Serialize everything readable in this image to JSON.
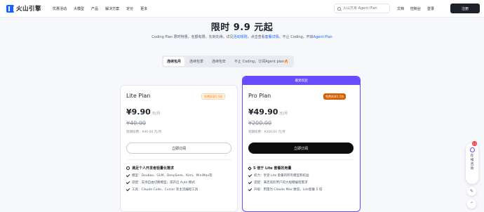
{
  "nav": {
    "logo": "火山引擎",
    "items": [
      "优惠活动",
      "大模型",
      "产品",
      "解决方案",
      "定价",
      "更多"
    ],
    "search_placeholder": "火山方舟 Agent Plan",
    "links": [
      "文档",
      "控制台",
      "登录"
    ],
    "register": "注册"
  },
  "hero": {
    "title": "限时 9.9 元起",
    "sub_text": "Coding Plan 限时特惠，名额有限，先到先得，详见",
    "sub_link1": "活动规则",
    "sub_mid": "，点击查看",
    "sub_link2": "套餐详情",
    "sub_tail": "。不止 Coding，开启",
    "sub_link3": "Agent Plan"
  },
  "tabs": [
    "连续包月",
    "连续包季",
    "连续包年",
    "不止 Coding，订阅Agent plan🔥"
  ],
  "lite": {
    "name": "Lite Plan",
    "badge": "免费再享5.5折",
    "price": "¥9.90",
    "unit": "元/月",
    "orig": "¥40.00",
    "renew": "到期续费：¥40.00 元/月",
    "button": "立即订阅",
    "feat_head": "满足个人开发者轻量化需求",
    "features": [
      "模型：Doubao、GLM、DeepSeek、Kimi、MiniMax等",
      "适配：支持自由切换模型，或开启 Auto 模式",
      "工具：Claude Code、Cursor 等主流编程工具"
    ]
  },
  "pro": {
    "banner": "最受欢迎",
    "name": "Pro Plan",
    "badge": "免费再享5.5折",
    "price": "¥49.90",
    "unit": "元/月",
    "orig": "¥200.00",
    "renew": "到期续费：¥200.00 元/月",
    "button": "立即订阅",
    "feat_head": "5 倍于 Lite 套餐的用量",
    "features": [
      "权力：享受 Lite 套餐的所有模型和权益",
      "适配：满足高阶用户的大规模编程需求",
      "升级：用量为 Claude Max 数倍，Lite套餐 5 倍"
    ]
  },
  "side": {
    "badge": "24",
    "label": "在线咨询"
  }
}
